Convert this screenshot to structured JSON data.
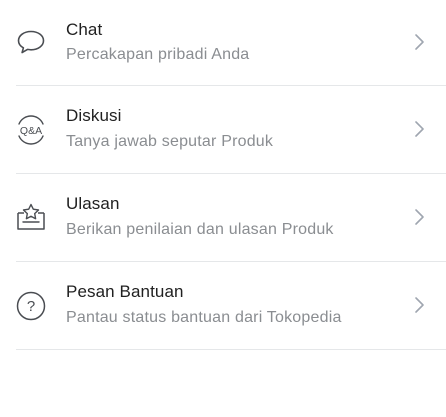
{
  "menu": {
    "items": [
      {
        "icon": "chat-bubble-icon",
        "title": "Chat",
        "subtitle": "Percakapan pribadi Anda"
      },
      {
        "icon": "qa-icon",
        "icon_text": "Q&A",
        "title": "Diskusi",
        "subtitle": "Tanya jawab seputar Produk"
      },
      {
        "icon": "review-star-icon",
        "title": "Ulasan",
        "subtitle": "Berikan penilaian dan ulasan Produk"
      },
      {
        "icon": "help-question-icon",
        "icon_text": "?",
        "title": "Pesan Bantuan",
        "subtitle": "Pantau status bantuan dari Tokopedia"
      }
    ]
  },
  "colors": {
    "title": "#212121",
    "subtitle": "#8a8d91",
    "icon": "#4a4d52",
    "chevron": "#9fa6b0",
    "divider": "#e5e7e9"
  }
}
